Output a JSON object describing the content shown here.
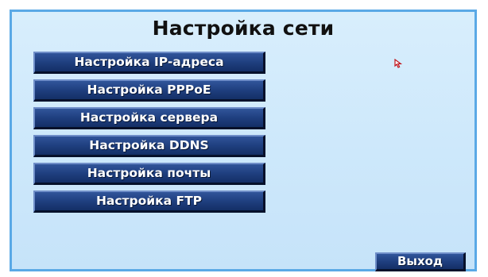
{
  "window": {
    "title": "Настройка сети"
  },
  "menu": {
    "items": [
      {
        "label": "Настройка IP-адреса"
      },
      {
        "label": "Настройка PPPoE"
      },
      {
        "label": "Настройка сервера"
      },
      {
        "label": "Настройка DDNS"
      },
      {
        "label": "Настройка почты"
      },
      {
        "label": "Настройка FTP"
      }
    ]
  },
  "footer": {
    "exit_label": "Выход"
  },
  "cursor": {
    "icon": "mouse-pointer-icon"
  },
  "colors": {
    "panel_background": "#cde8fb",
    "panel_border": "#5aa9e6",
    "button_background": "#1f3f7f",
    "button_text": "#ffffff",
    "title_text": "#111111"
  }
}
